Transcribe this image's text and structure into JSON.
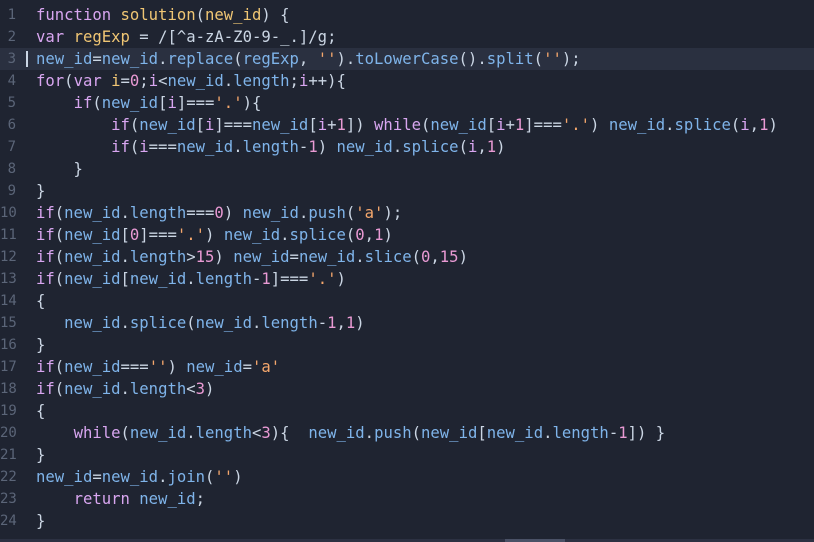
{
  "editor": {
    "language": "javascript",
    "current_line": 3,
    "lines": [
      {
        "num": "1",
        "tokens": [
          [
            "function ",
            "k"
          ],
          [
            "solution",
            "f"
          ],
          [
            "(",
            "p"
          ],
          [
            "new_id",
            "v"
          ],
          [
            ") {",
            "p"
          ]
        ]
      },
      {
        "num": "2",
        "tokens": [
          [
            "var ",
            "k"
          ],
          [
            "regExp",
            "v"
          ],
          [
            " = ",
            "p"
          ],
          [
            "/[^a-zA-Z0-9-_.]/g",
            "p"
          ],
          [
            ";",
            "p"
          ]
        ]
      },
      {
        "num": "3",
        "tokens": [
          [
            "new_id",
            "m"
          ],
          [
            "=",
            "p"
          ],
          [
            "new_id",
            "m"
          ],
          [
            ".",
            "p"
          ],
          [
            "replace",
            "m"
          ],
          [
            "(",
            "p"
          ],
          [
            "regExp",
            "m"
          ],
          [
            ", ",
            "p"
          ],
          [
            "''",
            "s"
          ],
          [
            ").",
            "p"
          ],
          [
            "toLowerCase",
            "m"
          ],
          [
            "().",
            "p"
          ],
          [
            "split",
            "m"
          ],
          [
            "(",
            "p"
          ],
          [
            "''",
            "s"
          ],
          [
            ");",
            "p"
          ]
        ]
      },
      {
        "num": "4",
        "tokens": [
          [
            "for",
            "k"
          ],
          [
            "(",
            "p"
          ],
          [
            "var ",
            "k"
          ],
          [
            "i",
            "v"
          ],
          [
            "=",
            "p"
          ],
          [
            "0",
            "n"
          ],
          [
            ";",
            "p"
          ],
          [
            "i",
            "k"
          ],
          [
            "<",
            "p"
          ],
          [
            "new_id",
            "m"
          ],
          [
            ".",
            "p"
          ],
          [
            "length",
            "m"
          ],
          [
            ";",
            "p"
          ],
          [
            "i",
            "k"
          ],
          [
            "++){",
            "p"
          ]
        ]
      },
      {
        "num": "5",
        "tokens": [
          [
            "    ",
            "p"
          ],
          [
            "if",
            "k"
          ],
          [
            "(",
            "p"
          ],
          [
            "new_id",
            "m"
          ],
          [
            "[",
            "p"
          ],
          [
            "i",
            "k"
          ],
          [
            "]===",
            "p"
          ],
          [
            "'.'",
            "s"
          ],
          [
            "){",
            "p"
          ]
        ]
      },
      {
        "num": "6",
        "tokens": [
          [
            "        ",
            "p"
          ],
          [
            "if",
            "k"
          ],
          [
            "(",
            "p"
          ],
          [
            "new_id",
            "m"
          ],
          [
            "[",
            "p"
          ],
          [
            "i",
            "k"
          ],
          [
            "]===",
            "p"
          ],
          [
            "new_id",
            "m"
          ],
          [
            "[",
            "p"
          ],
          [
            "i",
            "k"
          ],
          [
            "+",
            "p"
          ],
          [
            "1",
            "n"
          ],
          [
            "]) ",
            "p"
          ],
          [
            "while",
            "k"
          ],
          [
            "(",
            "p"
          ],
          [
            "new_id",
            "m"
          ],
          [
            "[",
            "p"
          ],
          [
            "i",
            "k"
          ],
          [
            "+",
            "p"
          ],
          [
            "1",
            "n"
          ],
          [
            "]===",
            "p"
          ],
          [
            "'.'",
            "s"
          ],
          [
            ") ",
            "p"
          ],
          [
            "new_id",
            "m"
          ],
          [
            ".",
            "p"
          ],
          [
            "splice",
            "m"
          ],
          [
            "(",
            "p"
          ],
          [
            "i",
            "k"
          ],
          [
            ",",
            "p"
          ],
          [
            "1",
            "n"
          ],
          [
            ")",
            "p"
          ]
        ]
      },
      {
        "num": "7",
        "tokens": [
          [
            "        ",
            "p"
          ],
          [
            "if",
            "k"
          ],
          [
            "(",
            "p"
          ],
          [
            "i",
            "k"
          ],
          [
            "===",
            "p"
          ],
          [
            "new_id",
            "m"
          ],
          [
            ".",
            "p"
          ],
          [
            "length",
            "m"
          ],
          [
            "-",
            "p"
          ],
          [
            "1",
            "n"
          ],
          [
            ") ",
            "p"
          ],
          [
            "new_id",
            "m"
          ],
          [
            ".",
            "p"
          ],
          [
            "splice",
            "m"
          ],
          [
            "(",
            "p"
          ],
          [
            "i",
            "k"
          ],
          [
            ",",
            "p"
          ],
          [
            "1",
            "n"
          ],
          [
            ")",
            "p"
          ]
        ]
      },
      {
        "num": "8",
        "tokens": [
          [
            "    }",
            "p"
          ]
        ]
      },
      {
        "num": "9",
        "tokens": [
          [
            "}",
            "p"
          ]
        ]
      },
      {
        "num": "10",
        "tokens": [
          [
            "if",
            "k"
          ],
          [
            "(",
            "p"
          ],
          [
            "new_id",
            "m"
          ],
          [
            ".",
            "p"
          ],
          [
            "length",
            "m"
          ],
          [
            "===",
            "p"
          ],
          [
            "0",
            "n"
          ],
          [
            ") ",
            "p"
          ],
          [
            "new_id",
            "m"
          ],
          [
            ".",
            "p"
          ],
          [
            "push",
            "m"
          ],
          [
            "(",
            "p"
          ],
          [
            "'a'",
            "s"
          ],
          [
            ");",
            "p"
          ]
        ]
      },
      {
        "num": "11",
        "tokens": [
          [
            "if",
            "k"
          ],
          [
            "(",
            "p"
          ],
          [
            "new_id",
            "m"
          ],
          [
            "[",
            "p"
          ],
          [
            "0",
            "n"
          ],
          [
            "]===",
            "p"
          ],
          [
            "'.'",
            "s"
          ],
          [
            ") ",
            "p"
          ],
          [
            "new_id",
            "m"
          ],
          [
            ".",
            "p"
          ],
          [
            "splice",
            "m"
          ],
          [
            "(",
            "p"
          ],
          [
            "0",
            "n"
          ],
          [
            ",",
            "p"
          ],
          [
            "1",
            "n"
          ],
          [
            ")",
            "p"
          ]
        ]
      },
      {
        "num": "12",
        "tokens": [
          [
            "if",
            "k"
          ],
          [
            "(",
            "p"
          ],
          [
            "new_id",
            "m"
          ],
          [
            ".",
            "p"
          ],
          [
            "length",
            "m"
          ],
          [
            ">",
            "p"
          ],
          [
            "15",
            "n"
          ],
          [
            ") ",
            "p"
          ],
          [
            "new_id",
            "m"
          ],
          [
            "=",
            "p"
          ],
          [
            "new_id",
            "m"
          ],
          [
            ".",
            "p"
          ],
          [
            "slice",
            "m"
          ],
          [
            "(",
            "p"
          ],
          [
            "0",
            "n"
          ],
          [
            ",",
            "p"
          ],
          [
            "15",
            "n"
          ],
          [
            ")",
            "p"
          ]
        ]
      },
      {
        "num": "13",
        "tokens": [
          [
            "if",
            "k"
          ],
          [
            "(",
            "p"
          ],
          [
            "new_id",
            "m"
          ],
          [
            "[",
            "p"
          ],
          [
            "new_id",
            "m"
          ],
          [
            ".",
            "p"
          ],
          [
            "length",
            "m"
          ],
          [
            "-",
            "p"
          ],
          [
            "1",
            "n"
          ],
          [
            "]===",
            "p"
          ],
          [
            "'.'",
            "s"
          ],
          [
            ")",
            "p"
          ]
        ]
      },
      {
        "num": "14",
        "tokens": [
          [
            "{",
            "p"
          ]
        ]
      },
      {
        "num": "15",
        "tokens": [
          [
            "   ",
            "p"
          ],
          [
            "new_id",
            "m"
          ],
          [
            ".",
            "p"
          ],
          [
            "splice",
            "m"
          ],
          [
            "(",
            "p"
          ],
          [
            "new_id",
            "m"
          ],
          [
            ".",
            "p"
          ],
          [
            "length",
            "m"
          ],
          [
            "-",
            "p"
          ],
          [
            "1",
            "n"
          ],
          [
            ",",
            "p"
          ],
          [
            "1",
            "n"
          ],
          [
            ")",
            "p"
          ]
        ]
      },
      {
        "num": "16",
        "tokens": [
          [
            "}",
            "p"
          ]
        ]
      },
      {
        "num": "17",
        "tokens": [
          [
            "if",
            "k"
          ],
          [
            "(",
            "p"
          ],
          [
            "new_id",
            "m"
          ],
          [
            "===",
            "p"
          ],
          [
            "''",
            "s"
          ],
          [
            ") ",
            "p"
          ],
          [
            "new_id",
            "m"
          ],
          [
            "=",
            "p"
          ],
          [
            "'a'",
            "s"
          ]
        ]
      },
      {
        "num": "18",
        "tokens": [
          [
            "if",
            "k"
          ],
          [
            "(",
            "p"
          ],
          [
            "new_id",
            "m"
          ],
          [
            ".",
            "p"
          ],
          [
            "length",
            "m"
          ],
          [
            "<",
            "p"
          ],
          [
            "3",
            "n"
          ],
          [
            ")",
            "p"
          ]
        ]
      },
      {
        "num": "19",
        "tokens": [
          [
            "{",
            "p"
          ]
        ]
      },
      {
        "num": "20",
        "tokens": [
          [
            "    ",
            "p"
          ],
          [
            "while",
            "k"
          ],
          [
            "(",
            "p"
          ],
          [
            "new_id",
            "m"
          ],
          [
            ".",
            "p"
          ],
          [
            "length",
            "m"
          ],
          [
            "<",
            "p"
          ],
          [
            "3",
            "n"
          ],
          [
            "){  ",
            "p"
          ],
          [
            "new_id",
            "m"
          ],
          [
            ".",
            "p"
          ],
          [
            "push",
            "m"
          ],
          [
            "(",
            "p"
          ],
          [
            "new_id",
            "m"
          ],
          [
            "[",
            "p"
          ],
          [
            "new_id",
            "m"
          ],
          [
            ".",
            "p"
          ],
          [
            "length",
            "m"
          ],
          [
            "-",
            "p"
          ],
          [
            "1",
            "n"
          ],
          [
            "]) }",
            "p"
          ]
        ]
      },
      {
        "num": "21",
        "tokens": [
          [
            "}",
            "p"
          ]
        ]
      },
      {
        "num": "22",
        "tokens": [
          [
            "new_id",
            "m"
          ],
          [
            "=",
            "p"
          ],
          [
            "new_id",
            "m"
          ],
          [
            ".",
            "p"
          ],
          [
            "join",
            "m"
          ],
          [
            "(",
            "p"
          ],
          [
            "''",
            "s"
          ],
          [
            ")",
            "p"
          ]
        ]
      },
      {
        "num": "23",
        "tokens": [
          [
            "    ",
            "p"
          ],
          [
            "return ",
            "k"
          ],
          [
            "new_id",
            "m"
          ],
          [
            ";",
            "p"
          ]
        ]
      },
      {
        "num": "24",
        "tokens": [
          [
            "}",
            "p"
          ]
        ]
      }
    ]
  },
  "colors": {
    "background": "#1f2431",
    "current_line": "#2a3040",
    "line_number": "#5b6578",
    "keyword": "#d8a6f0",
    "identifier": "#7fb4ea",
    "string": "#f5a76c",
    "number": "#e99ad4",
    "function_name": "#f0c674"
  }
}
